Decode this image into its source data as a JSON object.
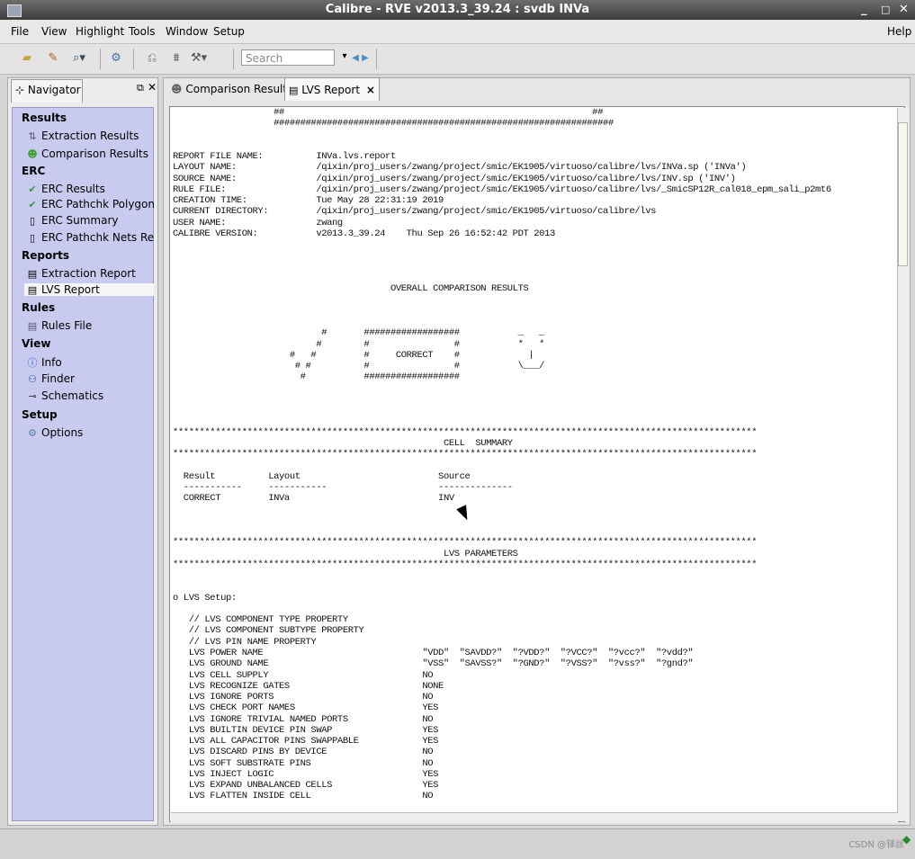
{
  "window": {
    "title": "Calibre - RVE v2013.3_39.24 : svdb INVa"
  },
  "menu": {
    "items": [
      "File",
      "View",
      "Highlight",
      "Tools",
      "Window",
      "Setup"
    ],
    "help": "Help"
  },
  "toolbar": {
    "search_placeholder": "Search"
  },
  "navigator": {
    "tab_label": "Navigator",
    "sections": {
      "results": "Results",
      "erc": "ERC",
      "reports": "Reports",
      "rules": "Rules",
      "view": "View",
      "setup": "Setup"
    },
    "items": {
      "extraction_results": "Extraction Results",
      "comparison_results": "Comparison Results",
      "erc_results": "ERC Results",
      "erc_pathchk_polygons": "ERC Pathchk Polygons",
      "erc_summary": "ERC Summary",
      "erc_pathchk_nets": "ERC Pathchk Nets Report",
      "extraction_report": "Extraction Report",
      "lvs_report": "LVS Report",
      "rules_file": "Rules File",
      "info": "Info",
      "finder": "Finder",
      "schematics": "Schematics",
      "options": "Options"
    }
  },
  "tabs": {
    "comparison": "Comparison Results",
    "lvs": "LVS Report",
    "close": "×"
  },
  "report": {
    "text": "                   ##                                                          ##\n                   ################################################################\n\n\nREPORT FILE NAME:          INVa.lvs.report\nLAYOUT NAME:               /qixin/proj_users/zwang/project/smic/EK1905/virtuoso/calibre/lvs/INVa.sp ('INVa')\nSOURCE NAME:               /qixin/proj_users/zwang/project/smic/EK1905/virtuoso/calibre/lvs/INV.sp ('INV')\nRULE FILE:                 /qixin/proj_users/zwang/project/smic/EK1905/virtuoso/calibre/lvs/_SmicSP12R_cal018_epm_sali_p2mt6\nCREATION TIME:             Tue May 28 22:31:19 2019\nCURRENT DIRECTORY:         /qixin/proj_users/zwang/project/smic/EK1905/virtuoso/calibre/lvs\nUSER NAME:                 zwang\nCALIBRE VERSION:           v2013.3_39.24    Thu Sep 26 16:52:42 PDT 2013\n\n\n\n\n                                         OVERALL COMPARISON RESULTS\n\n\n\n                            #       ##################           _   _\n                           #        #                #           *   *\n                      #   #         #     CORRECT    #             |\n                       # #          #                #           \\___/\n                        #           ##################\n\n\n\n\n**************************************************************************************************************\n                                                   CELL  SUMMARY\n**************************************************************************************************************\n\n  Result          Layout                          Source\n  -----------     -----------                     --------------\n  CORRECT         INVa                            INV\n\n\n\n**************************************************************************************************************\n                                                   LVS PARAMETERS\n**************************************************************************************************************\n\n\no LVS Setup:\n\n   // LVS COMPONENT TYPE PROPERTY\n   // LVS COMPONENT SUBTYPE PROPERTY\n   // LVS PIN NAME PROPERTY\n   LVS POWER NAME                              \"VDD\"  \"SAVDD?\"  \"?VDD?\"  \"?VCC?\"  \"?vcc?\"  \"?vdd?\"\n   LVS GROUND NAME                             \"VSS\"  \"SAVSS?\"  \"?GND?\"  \"?VSS?\"  \"?vss?\"  \"?gnd?\"\n   LVS CELL SUPPLY                             NO\n   LVS RECOGNIZE GATES                         NONE\n   LVS IGNORE PORTS                            NO\n   LVS CHECK PORT NAMES                        YES\n   LVS IGNORE TRIVIAL NAMED PORTS              NO\n   LVS BUILTIN DEVICE PIN SWAP                 YES\n   LVS ALL CAPACITOR PINS SWAPPABLE            YES\n   LVS DISCARD PINS BY DEVICE                  NO\n   LVS SOFT SUBSTRATE PINS                     NO\n   LVS INJECT LOGIC                            YES\n   LVS EXPAND UNBALANCED CELLS                 YES\n   LVS FLATTEN INSIDE CELL                     NO"
  },
  "watermark": "CSDN @铎丝"
}
